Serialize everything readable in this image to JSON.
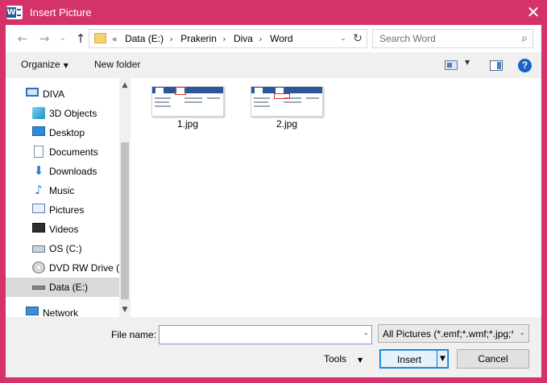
{
  "window": {
    "title": "Insert Picture",
    "app_icon": "word-icon",
    "close_glyph": "✕",
    "accent": "#d4326a"
  },
  "nav": {
    "back_glyph": "←",
    "forward_glyph": "→",
    "recent_glyph": "⌄",
    "up_glyph": "↑",
    "path_prefix": "«",
    "breadcrumbs": [
      "Data (E:)",
      "Prakerin",
      "Diva",
      "Word"
    ],
    "separator": "›",
    "dropdown_glyph": "⌄",
    "refresh_glyph": "↻",
    "search_placeholder": "Search Word",
    "search_glyph": "⌕"
  },
  "toolbar": {
    "organize": "Organize",
    "new_folder": "New folder",
    "caret": "▼",
    "help": "?"
  },
  "sidebar": {
    "items": [
      {
        "label": "DIVA",
        "icon": "this-pc-icon"
      },
      {
        "label": "3D Objects",
        "icon": "3d-objects-icon"
      },
      {
        "label": "Desktop",
        "icon": "desktop-icon"
      },
      {
        "label": "Documents",
        "icon": "documents-icon"
      },
      {
        "label": "Downloads",
        "icon": "downloads-icon"
      },
      {
        "label": "Music",
        "icon": "music-icon"
      },
      {
        "label": "Pictures",
        "icon": "pictures-icon"
      },
      {
        "label": "Videos",
        "icon": "videos-icon"
      },
      {
        "label": "OS (C:)",
        "icon": "drive-icon"
      },
      {
        "label": "DVD RW Drive (D",
        "icon": "dvd-icon"
      },
      {
        "label": "Data (E:)",
        "icon": "drive-icon",
        "selected": true
      },
      {
        "label": "Network",
        "icon": "network-icon"
      }
    ],
    "scroll_up": "▲",
    "scroll_down": "▼"
  },
  "files": [
    {
      "name": "1.jpg"
    },
    {
      "name": "2.jpg"
    }
  ],
  "footer": {
    "file_name_label": "File name:",
    "file_name_value": "",
    "filter_value": "All Pictures (*.emf;*.wmf;*.jpg;*",
    "tools": "Tools",
    "insert": "Insert",
    "cancel": "Cancel",
    "caret": "▼"
  }
}
